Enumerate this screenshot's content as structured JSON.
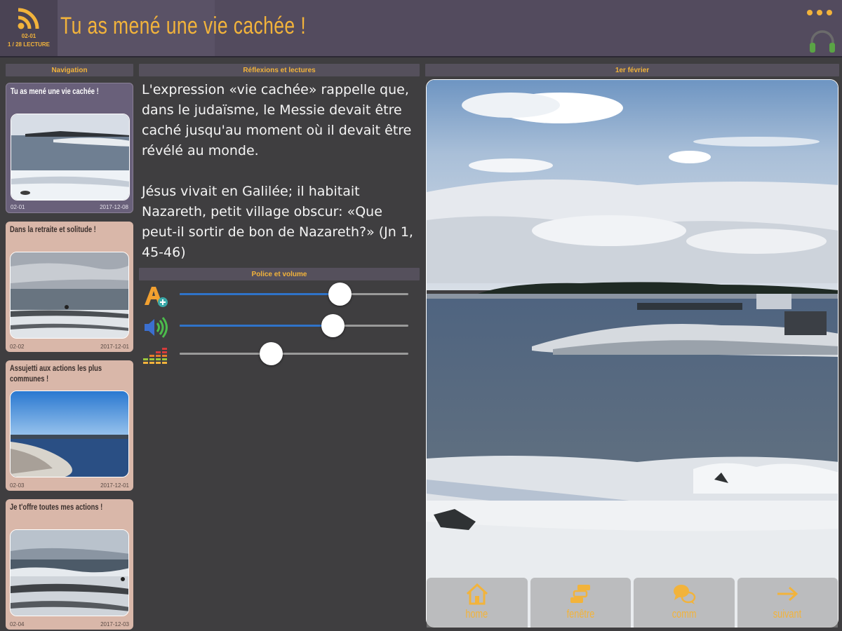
{
  "header": {
    "title": "Tu as mené une vie cachée !",
    "logo_code": "02-01",
    "logo_sub": "1 / 28  LECTURE",
    "icons": [
      "rss-icon",
      "more-icon",
      "headphones-icon"
    ]
  },
  "sections": {
    "navigation": "Navigation",
    "reflections": "Réflexions et lectures",
    "font_volume": "Police et volume",
    "date": "1er février"
  },
  "nav_cards": [
    {
      "title": "Tu as mené une vie cachée !",
      "code": "02-01",
      "date": "2017-12-08",
      "active": true
    },
    {
      "title": "Dans la retraite et solitude !",
      "code": "02-02",
      "date": "2017-12-01",
      "active": false
    },
    {
      "title": "Assujetti aux actions les plus communes !",
      "code": "02-03",
      "date": "2017-12-01",
      "active": false
    },
    {
      "title": "Je t'offre toutes mes actions !",
      "code": "02-04",
      "date": "2017-12-03",
      "active": false
    }
  ],
  "reflection_text": "L'expression «vie cachée» rappelle que, dans le judaïsme, le Messie devait être caché jusqu'au moment où il devait être révélé au monde.\n\nJésus vivait en Galilée; il habitait Nazareth, petit village obscur: «Que peut-il sortir de bon de Nazareth?» (Jn 1, 45-46)",
  "sliders": [
    {
      "name": "font-size",
      "icon": "font-size-plus-icon",
      "value": 0.7
    },
    {
      "name": "volume",
      "icon": "speaker-icon",
      "value": 0.67
    },
    {
      "name": "equalizer",
      "icon": "equalizer-icon",
      "value": 0.4
    }
  ],
  "bottom_nav": [
    {
      "label": "home",
      "icon": "home-icon"
    },
    {
      "label": "fenêtre",
      "icon": "windows-icon"
    },
    {
      "label": "comm",
      "icon": "chat-icon"
    },
    {
      "label": "suivant",
      "icon": "arrow-right-icon"
    }
  ],
  "colors": {
    "accent": "#f2b33b",
    "header_bg": "#534b5e",
    "body_bg": "#3f3e40",
    "card_tan": "#d9b7a9",
    "card_active": "#69607a",
    "slider_fill": "#2f73c9"
  }
}
